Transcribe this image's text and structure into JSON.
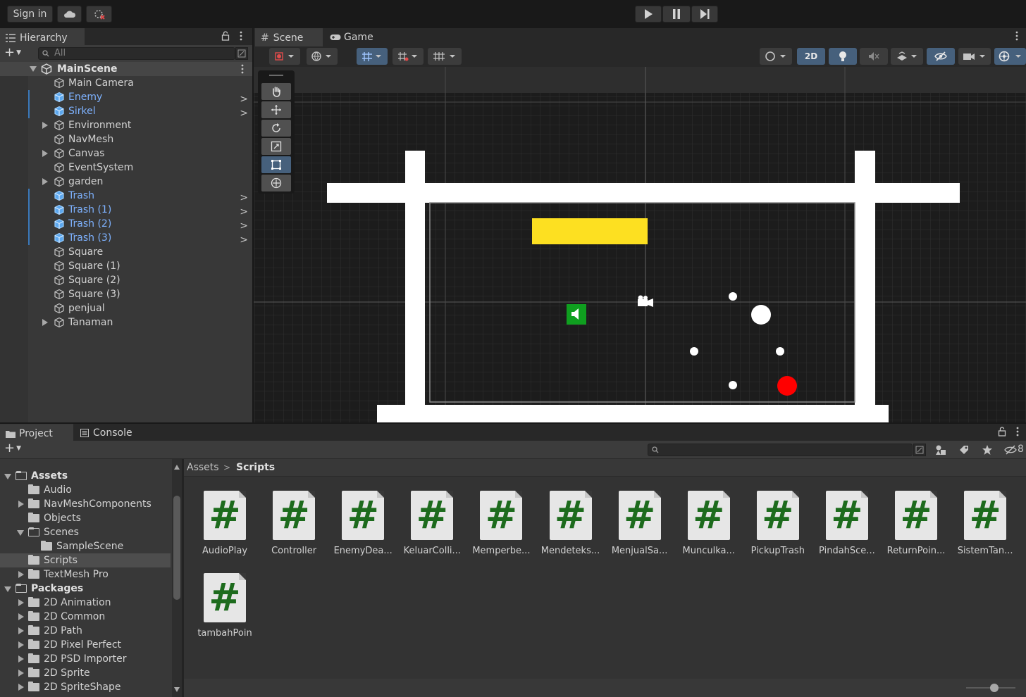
{
  "toolbar": {
    "sign_in": "Sign in"
  },
  "hierarchy": {
    "tab_label": "Hierarchy",
    "search_placeholder": "All",
    "scene_name": "MainScene",
    "items": [
      {
        "name": "Main Camera",
        "prefab": false,
        "expandable": false
      },
      {
        "name": "Enemy",
        "prefab": true,
        "expandable": false
      },
      {
        "name": "Sirkel",
        "prefab": true,
        "expandable": false
      },
      {
        "name": "Environment",
        "prefab": false,
        "expandable": true
      },
      {
        "name": "NavMesh",
        "prefab": false,
        "expandable": false
      },
      {
        "name": "Canvas",
        "prefab": false,
        "expandable": true
      },
      {
        "name": "EventSystem",
        "prefab": false,
        "expandable": false
      },
      {
        "name": "garden",
        "prefab": false,
        "expandable": true
      },
      {
        "name": "Trash",
        "prefab": true,
        "expandable": false
      },
      {
        "name": "Trash (1)",
        "prefab": true,
        "expandable": false
      },
      {
        "name": "Trash (2)",
        "prefab": true,
        "expandable": false
      },
      {
        "name": "Trash (3)",
        "prefab": true,
        "expandable": false
      },
      {
        "name": "Square",
        "prefab": false,
        "expandable": false
      },
      {
        "name": "Square (1)",
        "prefab": false,
        "expandable": false
      },
      {
        "name": "Square (2)",
        "prefab": false,
        "expandable": false
      },
      {
        "name": "Square (3)",
        "prefab": false,
        "expandable": false
      },
      {
        "name": "penjual",
        "prefab": false,
        "expandable": false
      },
      {
        "name": "Tanaman",
        "prefab": false,
        "expandable": true
      }
    ]
  },
  "scene": {
    "tab_scene": "Scene",
    "tab_game": "Game",
    "mode_2d": "2D"
  },
  "project": {
    "tab_project": "Project",
    "tab_console": "Console",
    "breadcrumb": [
      "Assets",
      "Scripts"
    ],
    "visibility_count": "8",
    "tree": [
      {
        "label": "Assets",
        "bold": true,
        "indent": 0,
        "arrow": "down"
      },
      {
        "label": "Audio",
        "indent": 1,
        "arrow": "none"
      },
      {
        "label": "NavMeshComponents",
        "indent": 1,
        "arrow": "right"
      },
      {
        "label": "Objects",
        "indent": 1,
        "arrow": "none"
      },
      {
        "label": "Scenes",
        "indent": 1,
        "arrow": "down"
      },
      {
        "label": "SampleScene",
        "indent": 2,
        "arrow": "none"
      },
      {
        "label": "Scripts",
        "indent": 1,
        "arrow": "none",
        "selected": true
      },
      {
        "label": "TextMesh Pro",
        "indent": 1,
        "arrow": "right"
      },
      {
        "label": "Packages",
        "bold": true,
        "indent": 0,
        "arrow": "down"
      },
      {
        "label": "2D Animation",
        "indent": 1,
        "arrow": "right"
      },
      {
        "label": "2D Common",
        "indent": 1,
        "arrow": "right"
      },
      {
        "label": "2D Path",
        "indent": 1,
        "arrow": "right"
      },
      {
        "label": "2D Pixel Perfect",
        "indent": 1,
        "arrow": "right"
      },
      {
        "label": "2D PSD Importer",
        "indent": 1,
        "arrow": "right"
      },
      {
        "label": "2D Sprite",
        "indent": 1,
        "arrow": "right"
      },
      {
        "label": "2D SpriteShape",
        "indent": 1,
        "arrow": "right"
      }
    ],
    "scripts": [
      "AudioPlay",
      "Controller",
      "EnemyDea...",
      "KeluarColli...",
      "Memperbe...",
      "Mendeteks...",
      "MenjualSa...",
      "Munculka...",
      "PickupTrash",
      "PindahSce...",
      "ReturnPoin...",
      "SistemTan...",
      "tambahPoin"
    ],
    "script_glyph": "#"
  },
  "colors": {
    "yellow_block": "#fde021",
    "green_speaker": "#0f9f1f",
    "red_ball": "#ff0000",
    "prefab_blue": "#7eb2ff",
    "selection_blue": "#46607c"
  }
}
